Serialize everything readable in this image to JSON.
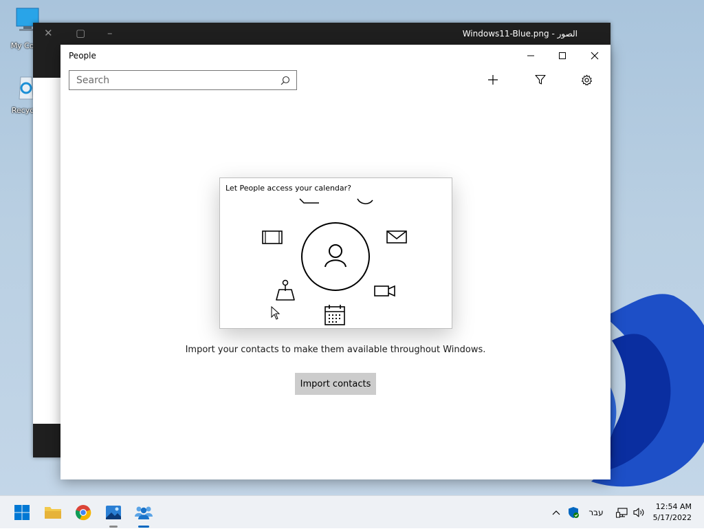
{
  "desktop": {
    "icons": [
      {
        "label": "My Com"
      },
      {
        "label": "Recycle"
      }
    ]
  },
  "photos_window": {
    "title": "Windows11-Blue.png - الصور"
  },
  "people_window": {
    "title": "People",
    "search": {
      "placeholder": "Search"
    },
    "illustration_caption": "Let People access your calendar?",
    "description": "Import your contacts to make them available throughout Windows.",
    "import_button": "Import contacts"
  },
  "taskbar": {
    "apps": [
      "start-icon",
      "file-explorer-icon",
      "chrome-icon",
      "photos-icon",
      "people-icon"
    ],
    "language": "עבר",
    "time": "12:54 AM",
    "date": "5/17/2022"
  },
  "colors": {
    "accent": "#0067c0",
    "button_bg": "#cccccc"
  }
}
